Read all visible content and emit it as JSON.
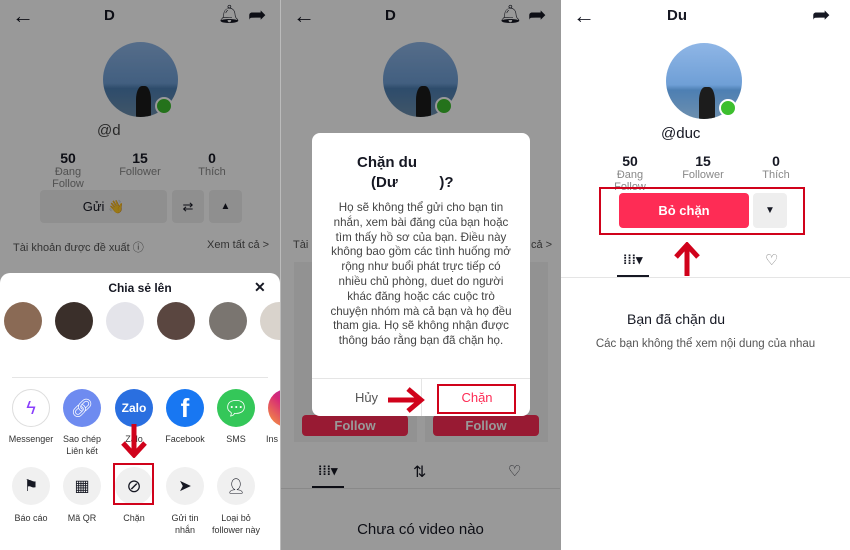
{
  "colors": {
    "accent": "#fe2c55",
    "annotation": "#d0021b",
    "online": "#3dbf2e"
  },
  "profile": {
    "title_partial_1": "D",
    "title_partial_3": "Du",
    "handle_partial_1": "@d",
    "handle_partial_3": "@duc",
    "stats": [
      {
        "value": "50",
        "label": "Đang Follow"
      },
      {
        "value": "15",
        "label": "Follower"
      },
      {
        "value": "0",
        "label": "Thích"
      }
    ]
  },
  "panel1": {
    "send_button": "Gửi 👋",
    "suggested_label": "Tài khoản được đề xuất ⓘ",
    "see_all": "Xem tất cả >",
    "share_sheet": {
      "title": "Chia sẻ lên",
      "close": "✕",
      "apps": [
        {
          "label": "Messenger",
          "icon": "messenger-icon"
        },
        {
          "label": "Sao chép\nLiên kết",
          "icon": "link-icon"
        },
        {
          "label": "Zalo",
          "icon": "zalo-icon"
        },
        {
          "label": "Facebook",
          "icon": "facebook-icon"
        },
        {
          "label": "SMS",
          "icon": "sms-icon"
        },
        {
          "label": "Ins",
          "icon": "instagram-icon"
        }
      ],
      "actions": [
        {
          "label": "Báo cáo",
          "icon": "flag-icon"
        },
        {
          "label": "Mã QR",
          "icon": "qr-icon"
        },
        {
          "label": "Chặn",
          "icon": "block-icon"
        },
        {
          "label": "Gửi tin\nnhắn",
          "icon": "send-icon"
        },
        {
          "label": "Loại bỏ\nfollower này",
          "icon": "remove-user-icon"
        }
      ]
    }
  },
  "panel2": {
    "dialog": {
      "title_line1": "Chặn du",
      "title_line2": "(Dư          )?",
      "body": "Họ sẽ không thể gửi cho bạn tin nhắn, xem bài đăng của bạn hoặc tìm thấy hồ sơ của bạn. Điều này không bao gồm các tình huống mở rộng như buổi phát trực tiếp có nhiều chủ phòng, duet do người khác đăng hoặc các cuộc trò chuyện nhóm mà cả bạn và họ đều tham gia. Họ sẽ không nhận được thông báo rằng bạn đã chặn họ.",
      "cancel": "Hủy",
      "confirm": "Chặn"
    },
    "follow_label": "Follow",
    "empty_text": "Chưa có video nào",
    "suggested_partial": "Tài",
    "see_all_partial": "cả >"
  },
  "panel3": {
    "unblock_button": "Bỏ chặn",
    "blocked_title": "Bạn đã chặn du",
    "blocked_sub": "Các bạn không thể xem nội dung của nhau"
  }
}
